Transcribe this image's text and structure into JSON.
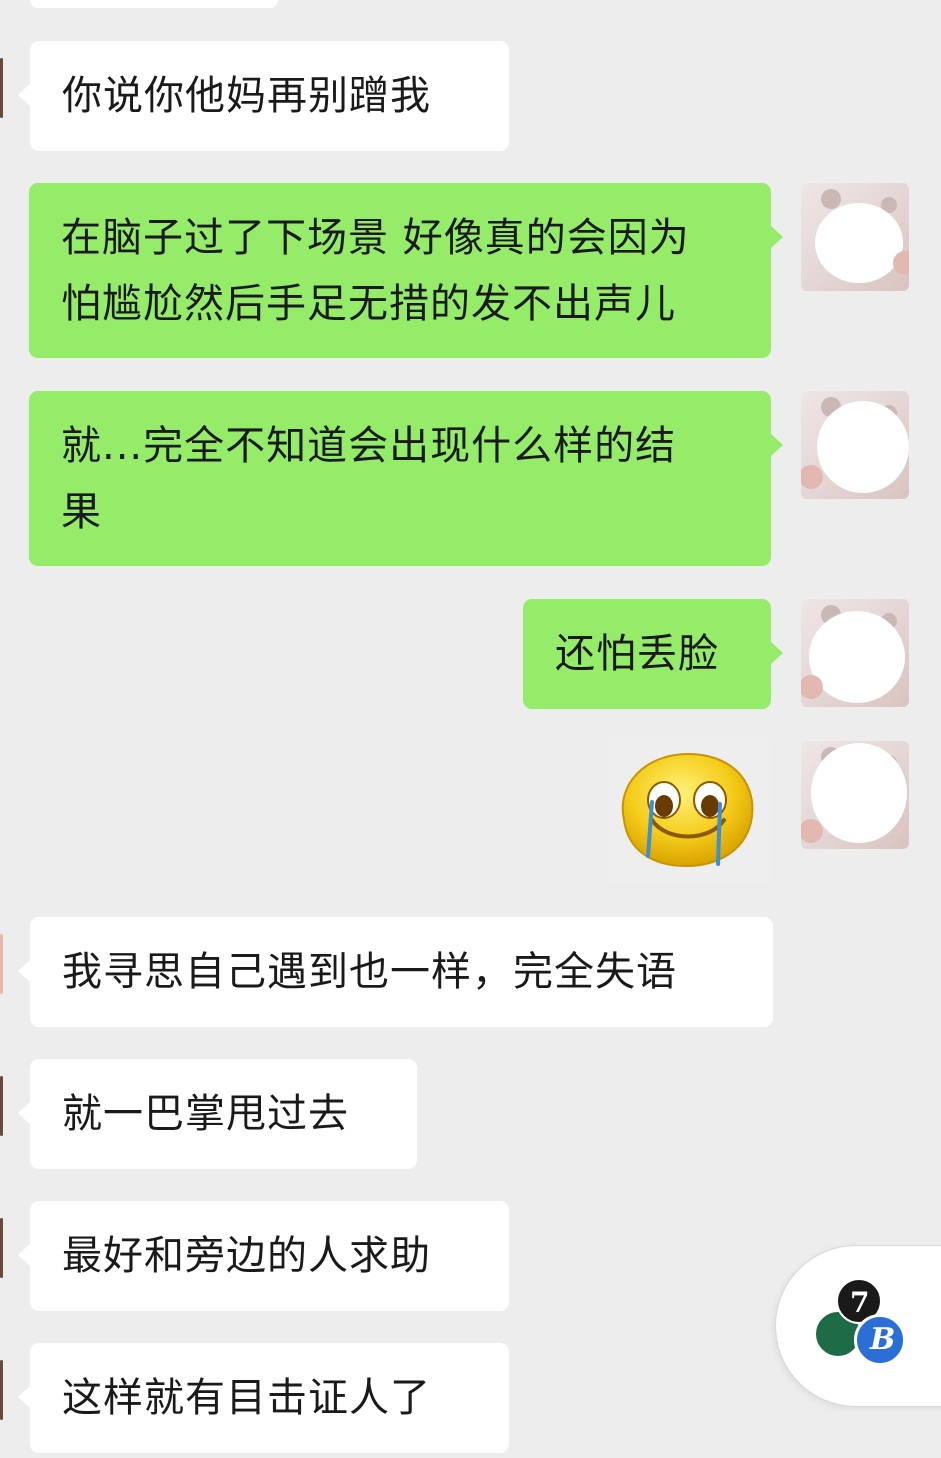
{
  "messages": [
    {
      "side": "in",
      "text": "你说你他妈再别蹭我"
    },
    {
      "side": "out",
      "line1": "在脑子过了下场景 好像真的会因为",
      "line2": "怕尴尬然后手足无措的发不出声儿"
    },
    {
      "side": "out",
      "line1": "就...完全不知道会出现什么样的结",
      "line2": "果"
    },
    {
      "side": "out",
      "text": "还怕丢脸"
    },
    {
      "side": "out",
      "sticker": "crying-smiley-icon"
    },
    {
      "side": "in",
      "text": "我寻思自己遇到也一样，完全失语"
    },
    {
      "side": "in",
      "text": "就一巴掌甩过去"
    },
    {
      "side": "in",
      "text": "最好和旁边的人求助"
    },
    {
      "side": "in",
      "text": "这样就有目击证人了"
    }
  ],
  "floating_widget": {
    "badge_1": "7",
    "badge_2": "B"
  },
  "colors": {
    "background": "#ededed",
    "incoming": "#ffffff",
    "outgoing": "#95ec69"
  }
}
